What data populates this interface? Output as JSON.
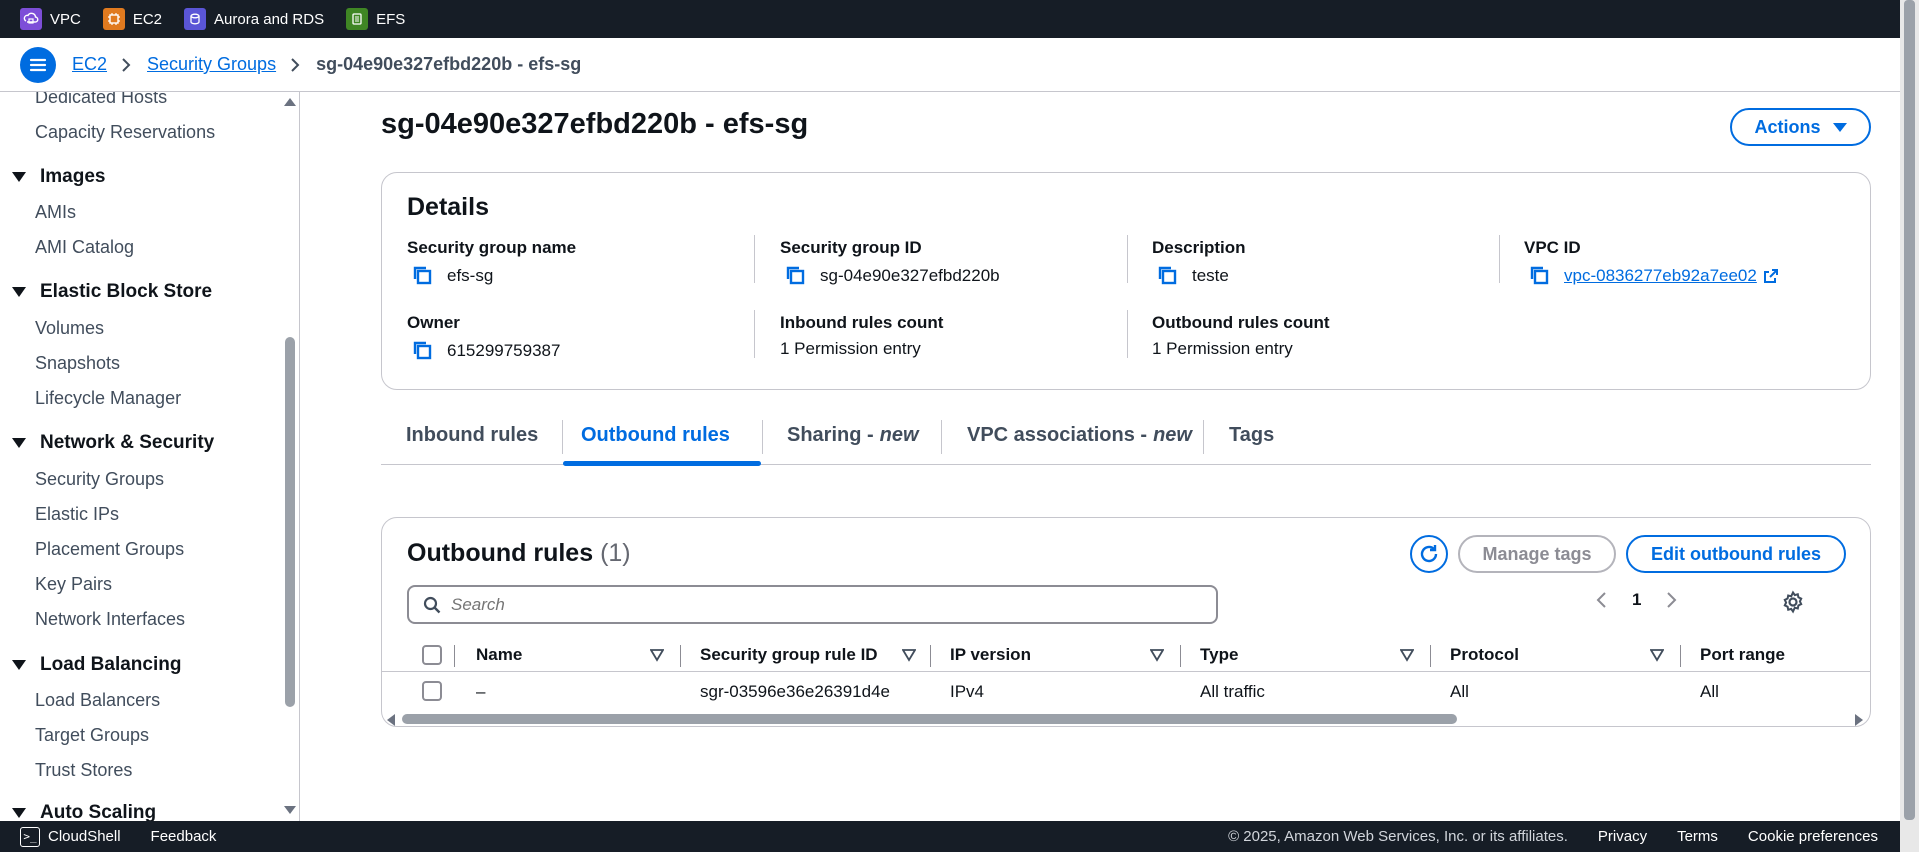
{
  "services": [
    {
      "label": "VPC",
      "color": "#7d4ed8"
    },
    {
      "label": "EC2",
      "color": "#e07a1f"
    },
    {
      "label": "Aurora and RDS",
      "color": "#5a55d6"
    },
    {
      "label": "EFS",
      "color": "#3f8624"
    }
  ],
  "breadcrumb": {
    "items": [
      "EC2",
      "Security Groups"
    ],
    "current": "sg-04e90e327efbd220b - efs-sg"
  },
  "sidebar": {
    "items": [
      {
        "type": "item",
        "label": "Dedicated Hosts"
      },
      {
        "type": "item",
        "label": "Capacity Reservations"
      },
      {
        "type": "section",
        "label": "Images"
      },
      {
        "type": "item",
        "label": "AMIs"
      },
      {
        "type": "item",
        "label": "AMI Catalog"
      },
      {
        "type": "section",
        "label": "Elastic Block Store"
      },
      {
        "type": "item",
        "label": "Volumes"
      },
      {
        "type": "item",
        "label": "Snapshots"
      },
      {
        "type": "item",
        "label": "Lifecycle Manager"
      },
      {
        "type": "section",
        "label": "Network & Security"
      },
      {
        "type": "item",
        "label": "Security Groups"
      },
      {
        "type": "item",
        "label": "Elastic IPs"
      },
      {
        "type": "item",
        "label": "Placement Groups"
      },
      {
        "type": "item",
        "label": "Key Pairs"
      },
      {
        "type": "item",
        "label": "Network Interfaces"
      },
      {
        "type": "section",
        "label": "Load Balancing"
      },
      {
        "type": "item",
        "label": "Load Balancers"
      },
      {
        "type": "item",
        "label": "Target Groups"
      },
      {
        "type": "item",
        "label": "Trust Stores"
      },
      {
        "type": "section",
        "label": "Auto Scaling"
      }
    ]
  },
  "page": {
    "title": "sg-04e90e327efbd220b - efs-sg",
    "actions_label": "Actions"
  },
  "details": {
    "title": "Details",
    "fields": {
      "sg_name": {
        "label": "Security group name",
        "value": "efs-sg"
      },
      "sg_id": {
        "label": "Security group ID",
        "value": "sg-04e90e327efbd220b"
      },
      "description": {
        "label": "Description",
        "value": "teste"
      },
      "vpc_id": {
        "label": "VPC ID",
        "value": "vpc-0836277eb92a7ee02"
      },
      "owner": {
        "label": "Owner",
        "value": "615299759387"
      },
      "inbound_count": {
        "label": "Inbound rules count",
        "value": "1 Permission entry"
      },
      "outbound_count": {
        "label": "Outbound rules count",
        "value": "1 Permission entry"
      }
    }
  },
  "tabs": {
    "inbound": "Inbound rules",
    "outbound": "Outbound rules",
    "sharing": "Sharing - ",
    "sharing_new": "new",
    "vpc_assoc": "VPC associations - ",
    "vpc_assoc_new": "new",
    "tags": "Tags",
    "active": "outbound"
  },
  "rules": {
    "title": "Outbound rules",
    "count": "(1)",
    "manage_tags": "Manage tags",
    "edit_label": "Edit outbound rules",
    "search_placeholder": "Search",
    "page": "1",
    "columns": {
      "name": "Name",
      "rule_id": "Security group rule ID",
      "ip_version": "IP version",
      "type": "Type",
      "protocol": "Protocol",
      "port_range": "Port range"
    },
    "rows": [
      {
        "name": "–",
        "rule_id": "sgr-03596e36e26391d4e",
        "ip_version": "IPv4",
        "type": "All traffic",
        "protocol": "All",
        "port_range": "All"
      }
    ]
  },
  "footer": {
    "cloudshell": "CloudShell",
    "feedback": "Feedback",
    "copyright": "© 2025, Amazon Web Services, Inc. or its affiliates.",
    "privacy": "Privacy",
    "terms": "Terms",
    "cookie": "Cookie preferences"
  },
  "colors": {
    "accent": "#006ce0",
    "topbar": "#161d26"
  }
}
